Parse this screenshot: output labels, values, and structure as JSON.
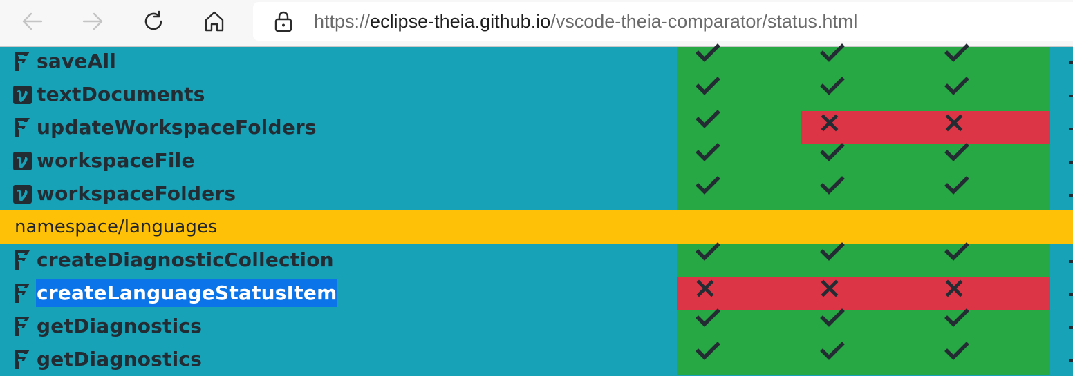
{
  "browser": {
    "url_prefix": "https://",
    "url_host": "eclipse-theia.github.io",
    "url_path": "/vscode-theia-comparator/status.html"
  },
  "colors": {
    "page_background": "#17a2b8",
    "supported": "#28a745",
    "unsupported": "#dc3545",
    "section": "#ffc107",
    "selection": "#0a74e8"
  },
  "rows": [
    {
      "type": "api",
      "icon": "function-icon",
      "name": "saveAll",
      "status": [
        "check",
        "check",
        "check"
      ]
    },
    {
      "type": "api",
      "icon": "variable-icon",
      "name": "textDocuments",
      "status": [
        "check",
        "check",
        "check"
      ]
    },
    {
      "type": "api",
      "icon": "function-icon",
      "name": "updateWorkspaceFolders",
      "status": [
        "check",
        "cross",
        "cross"
      ]
    },
    {
      "type": "api",
      "icon": "variable-icon",
      "name": "workspaceFile",
      "status": [
        "check",
        "check",
        "check"
      ]
    },
    {
      "type": "api",
      "icon": "variable-icon",
      "name": "workspaceFolders",
      "status": [
        "check",
        "check",
        "check"
      ]
    },
    {
      "type": "section",
      "name": "namespace/languages"
    },
    {
      "type": "api",
      "icon": "function-icon",
      "name": "createDiagnosticCollection",
      "status": [
        "check",
        "check",
        "check"
      ]
    },
    {
      "type": "api",
      "icon": "function-icon",
      "name": "createLanguageStatusItem",
      "selected": true,
      "status": [
        "cross",
        "cross",
        "cross"
      ]
    },
    {
      "type": "api",
      "icon": "function-icon",
      "name": "getDiagnostics",
      "status": [
        "check",
        "check",
        "check"
      ]
    },
    {
      "type": "api",
      "icon": "function-icon",
      "name": "getDiagnostics",
      "status": [
        "check",
        "check",
        "check"
      ]
    }
  ]
}
